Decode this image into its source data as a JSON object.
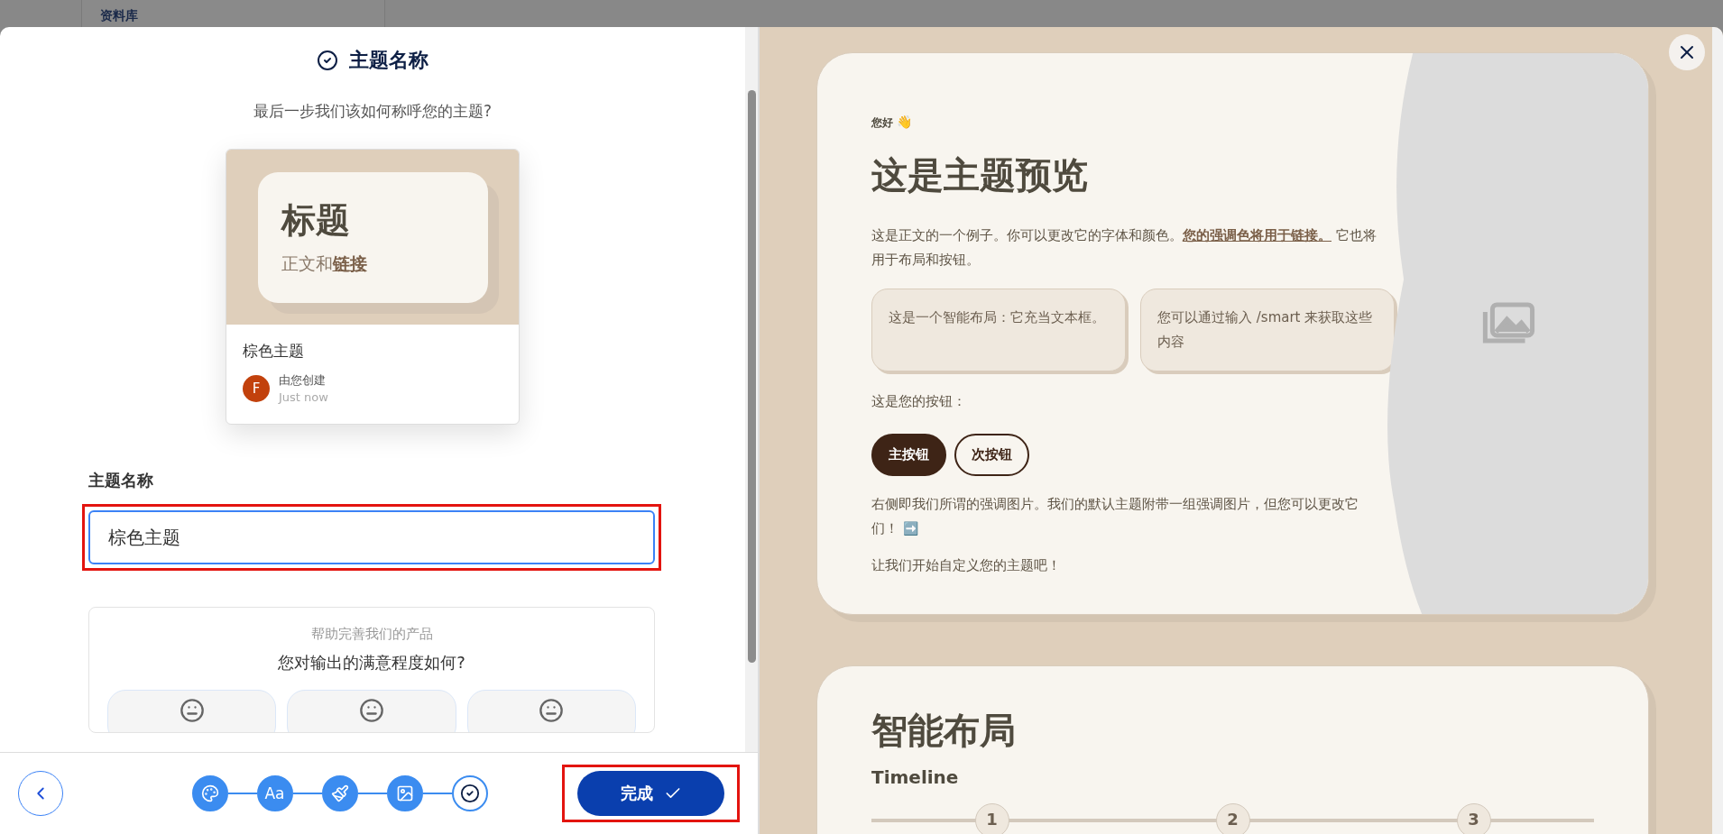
{
  "background_tab": {
    "label": "资料库"
  },
  "wizard": {
    "title": "主题名称",
    "subtitle": "最后一步我们该如何称呼您的主题?",
    "theme_card": {
      "preview_heading": "标题",
      "preview_body": "正文和",
      "preview_link": "链接",
      "name": "棕色主题",
      "avatar_letter": "F",
      "creator": "由您创建",
      "time": "Just now"
    },
    "name_field": {
      "label": "主题名称",
      "value": "棕色主题",
      "highlighted": true
    },
    "feedback": {
      "caption": "帮助完善我们的产品",
      "question": "您对输出的满意程度如何?",
      "options": [
        {
          "kind": "face"
        },
        {
          "kind": "face"
        },
        {
          "kind": "face"
        }
      ]
    },
    "steps": [
      {
        "kind": "palette",
        "current": false
      },
      {
        "kind": "text",
        "label": "Aa",
        "current": false
      },
      {
        "kind": "brush",
        "current": false
      },
      {
        "kind": "image",
        "current": false
      },
      {
        "kind": "check",
        "current": true
      }
    ],
    "done_button": {
      "label": "完成",
      "highlighted": true
    }
  },
  "preview": {
    "greeting": "您好",
    "greeting_emoji": "👋",
    "heading": "这是主题预览",
    "body": "这是正文的一个例子。你可以更改它的字体和颜色。",
    "body_link": "您的强调色将用于链接。",
    "body_tail": " 它也将用于布局和按钮。",
    "boxes": [
      "这是一个智能布局：它充当文本框。",
      "您可以通过输入 /smart 来获取这些内容"
    ],
    "buttons_label": "这是您的按钮：",
    "buttons": [
      {
        "label": "主按钮",
        "kind": "primary"
      },
      {
        "label": "次按钮",
        "kind": "secondary"
      }
    ],
    "accent_text": "右侧即我们所谓的强调图片。我们的默认主题附带一组强调图片，但您可以更改它们！",
    "accent_emoji": "➡️",
    "closing": "让我们开始自定义您的主题吧！"
  },
  "smart_layout": {
    "heading": "智能布局",
    "subheading": "Timeline",
    "timeline": [
      "1",
      "2",
      "3"
    ]
  }
}
